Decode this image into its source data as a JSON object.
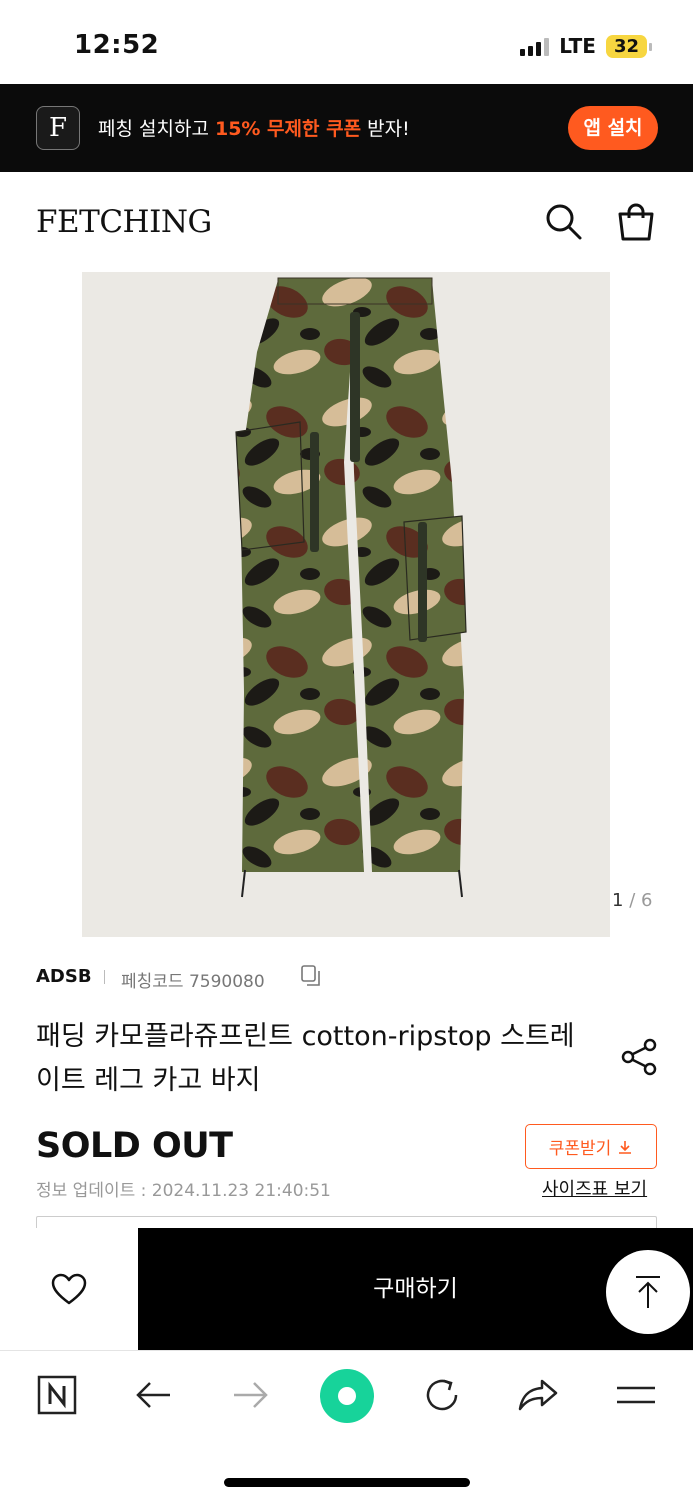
{
  "status_bar": {
    "time": "12:52",
    "network": "LTE",
    "battery": "32"
  },
  "app_banner": {
    "logo_letter": "F",
    "message_prefix": "페칭 설치하고 ",
    "message_highlight": "15% 무제한 쿠폰",
    "message_suffix": " 받자!",
    "install_label": "앱 설치",
    "accent_color": "#ff5a1f"
  },
  "header": {
    "wordmark": "FETCHING",
    "icons": [
      "search-icon",
      "shopping-bag-icon"
    ]
  },
  "gallery": {
    "current": "1",
    "separator": "/",
    "total": "6"
  },
  "product": {
    "brand": "ADSB",
    "code_label": "페칭코드 7590080",
    "title": "패딩 카모플라쥬프린트 cotton-ripstop 스트레이트 레그 카고 바지",
    "status": "SOLD OUT",
    "updated": "정보 업데이트 : 2024.11.23 21:40:51",
    "coupon_label": "쿠폰받기",
    "size_chart_label": "사이즈표 보기"
  },
  "purchase_bar": {
    "buy_label": "구매하기"
  },
  "browser_toolbar": {
    "icons": [
      "naver-home-icon",
      "back-arrow-icon",
      "forward-arrow-icon",
      "green-dot-icon",
      "refresh-icon",
      "share-arrow-icon",
      "menu-icon"
    ]
  }
}
